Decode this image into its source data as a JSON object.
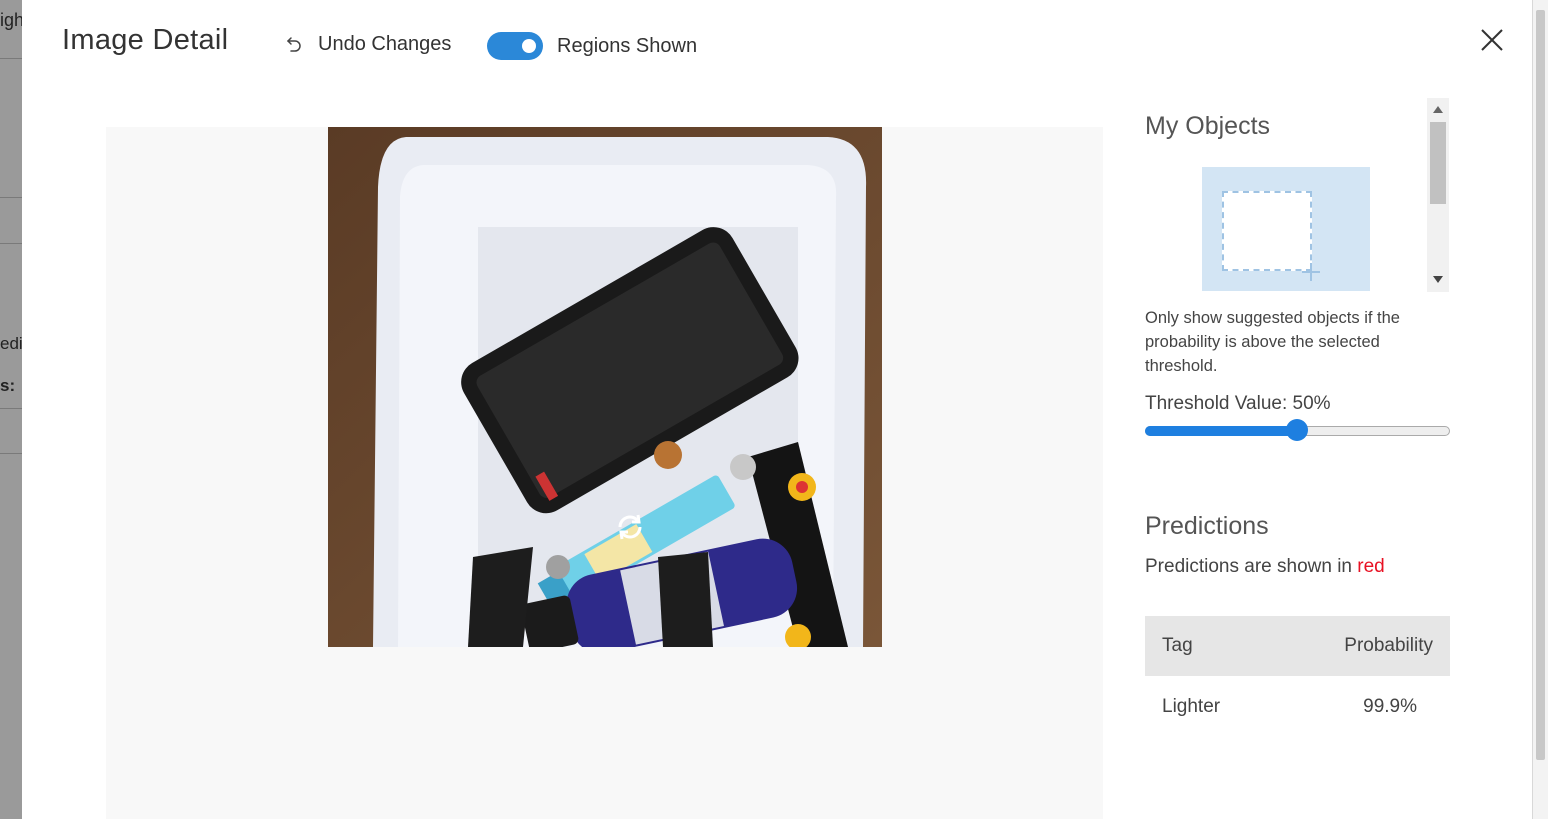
{
  "background_fragments": [
    "igh",
    "edi",
    "s:"
  ],
  "header": {
    "title": "Image Detail",
    "undo_label": "Undo Changes",
    "toggle_label": "Regions Shown",
    "toggle_on": true
  },
  "icons": {
    "undo": "undo-icon",
    "close": "close-icon",
    "rotate": "rotate-icon",
    "add_region": "add-region-icon"
  },
  "colors": {
    "accent": "#2b88d8",
    "slider": "#1e7fe0",
    "prediction_red": "#e81123",
    "add_object_bg": "#d3e5f4"
  },
  "sidebar": {
    "my_objects_title": "My Objects",
    "threshold_description": "Only show suggested objects if the probability is above the selected threshold.",
    "threshold_label": "Threshold Value: 50%",
    "threshold_value": 0.5,
    "predictions_title": "Predictions",
    "predictions_note_prefix": "Predictions are shown in ",
    "predictions_note_color": "red",
    "table": {
      "headers": [
        "Tag",
        "Probability"
      ],
      "rows": [
        {
          "tag": "Lighter",
          "probability": "99.9%"
        }
      ]
    }
  }
}
